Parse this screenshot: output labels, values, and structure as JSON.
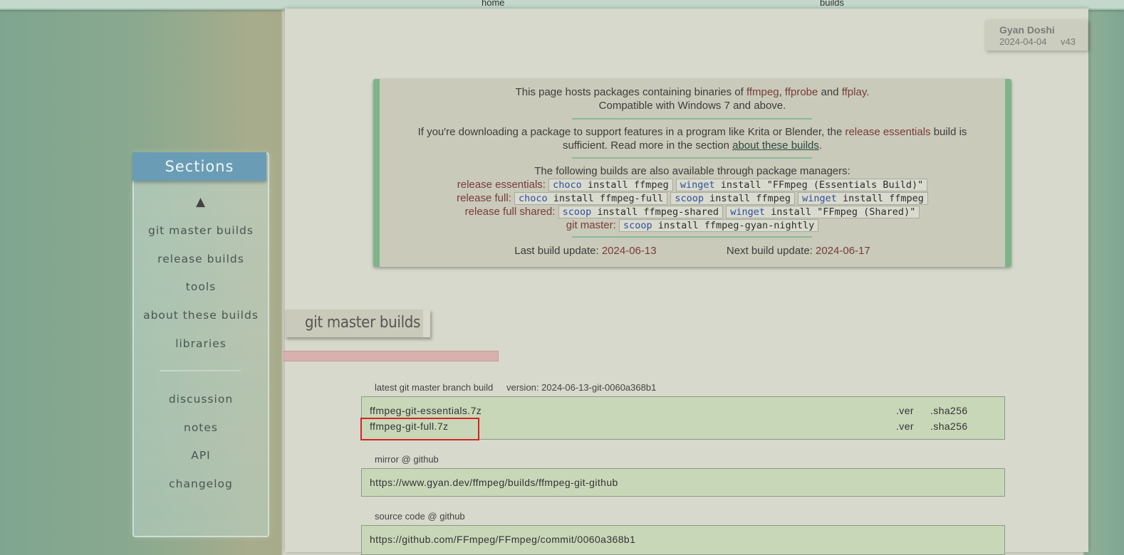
{
  "topnav": {
    "home": "home",
    "builds": "builds"
  },
  "author": {
    "name": "Gyan Doshi",
    "date": "2024-04-04",
    "version": "v43"
  },
  "info": {
    "line1_pre": "This page hosts packages containing binaries of ",
    "ffmpeg": "ffmpeg",
    "comma": ", ",
    "ffprobe": "ffprobe",
    "and": " and ",
    "ffplay": "ffplay",
    "dot": ".",
    "line2": "Compatible with Windows 7 and above.",
    "line3_pre": "If you're downloading a package to support features in a program like Krita or Blender, the ",
    "release_essentials": "release essentials",
    "line3_post": " build is",
    "line4_pre": "sufficient. Read more in the section ",
    "about_link": "about these builds",
    "line4_post": ".",
    "pkg_intro": "The following builds are also available through package managers:",
    "rows": [
      {
        "label": "release essentials:",
        "cmds": [
          {
            "kw": "choco",
            "rest": " install ffmpeg"
          },
          {
            "kw": "winget",
            "rest": " install \"FFmpeg (Essentials Build)\""
          }
        ]
      },
      {
        "label": "release full:",
        "cmds": [
          {
            "kw": "choco",
            "rest": " install ffmpeg-full"
          },
          {
            "kw": "scoop",
            "rest": " install ffmpeg"
          },
          {
            "kw": "winget",
            "rest": " install ffmpeg"
          }
        ]
      },
      {
        "label": "release full shared:",
        "cmds": [
          {
            "kw": "scoop",
            "rest": " install ffmpeg-shared"
          },
          {
            "kw": "winget",
            "rest": " install \"FFmpeg (Shared)\""
          }
        ]
      },
      {
        "label": "git master:",
        "cmds": [
          {
            "kw": "scoop",
            "rest": " install ffmpeg-gyan-nightly"
          }
        ]
      }
    ],
    "last_update_label": "Last build update: ",
    "last_update": "2024-06-13",
    "next_update_label": "Next build update: ",
    "next_update": "2024-06-17"
  },
  "sidebar": {
    "title": "Sections",
    "up": "▲",
    "items": [
      "git master builds",
      "release builds",
      "tools",
      "about these builds",
      "libraries",
      "discussion",
      "notes",
      "API",
      "changelog"
    ]
  },
  "section": {
    "title": "git master builds"
  },
  "latest": {
    "label": "latest git master branch build",
    "version": "version: 2024-06-13-git-0060a368b1",
    "files": [
      {
        "name": "ffmpeg-git-essentials.7z",
        "ver": ".ver",
        "sha": ".sha256"
      },
      {
        "name": "ffmpeg-git-full.7z",
        "ver": ".ver",
        "sha": ".sha256"
      }
    ]
  },
  "mirror": {
    "label": "mirror @ github",
    "url": "https://www.gyan.dev/ffmpeg/builds/ffmpeg-git-github"
  },
  "source": {
    "label": "source code @ github",
    "url": "https://github.com/FFmpeg/FFmpeg/commit/0060a368b1"
  }
}
